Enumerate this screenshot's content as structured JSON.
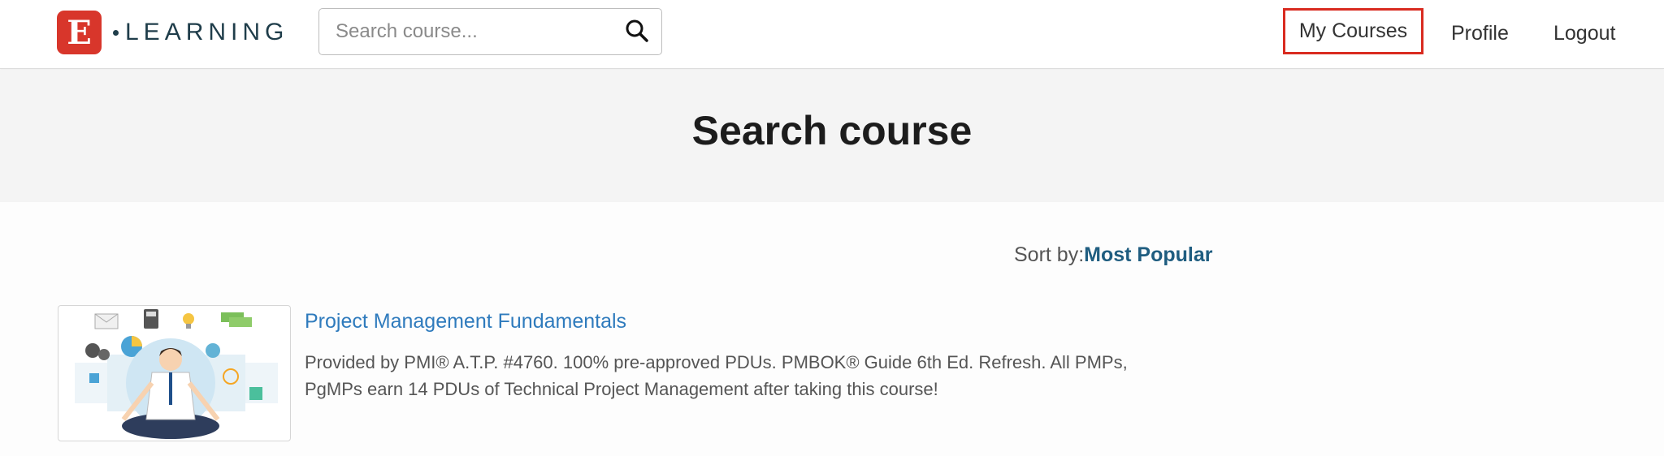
{
  "header": {
    "logo_letter": "E",
    "logo_word": "LEARNING",
    "search_placeholder": "Search course...",
    "nav": {
      "my_courses": "My Courses",
      "profile": "Profile",
      "logout": "Logout"
    },
    "highlight_color": "#d92b20",
    "brand_color": "#d8362b"
  },
  "page": {
    "title": "Search course"
  },
  "sort": {
    "label": "Sort by:",
    "value": "Most Popular"
  },
  "courses": [
    {
      "title": "Project Management Fundamentals",
      "description_line1": "Provided by PMI® A.T.P. #4760. 100% pre-approved PDUs. PMBOK® Guide 6th Ed. Refresh. All PMPs,",
      "description_line2": "PgMPs earn 14 PDUs of Technical Project Management after taking this course!",
      "thumbnail": "meditating-businessman-illustration"
    }
  ]
}
